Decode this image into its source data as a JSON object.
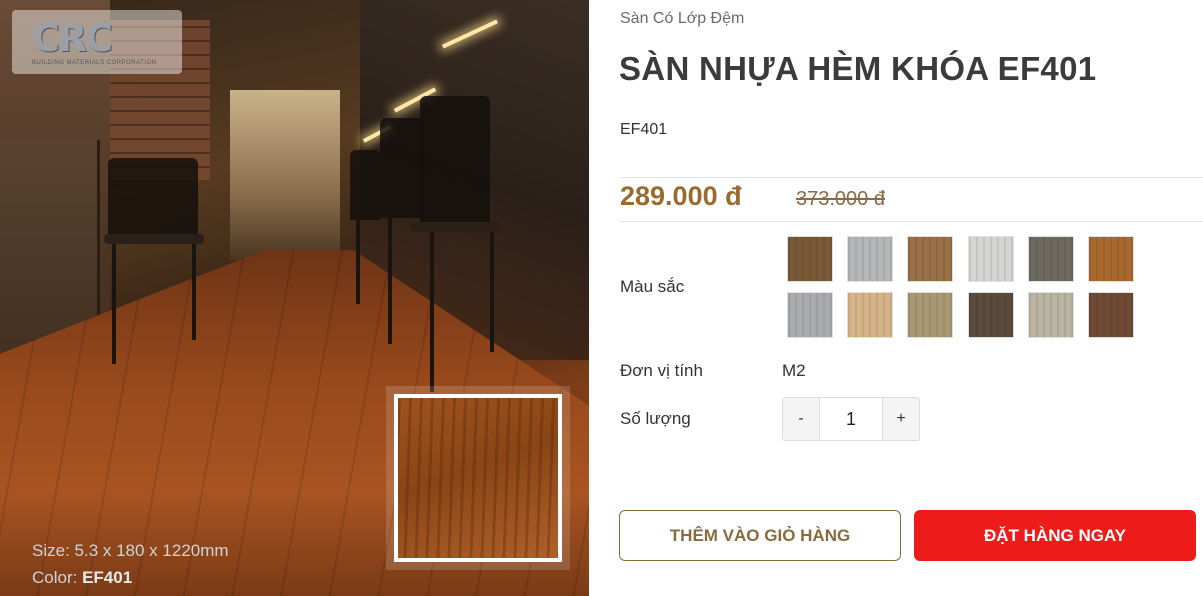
{
  "logo": {
    "mark": "CRC",
    "tagline": "BUILDING MATERIALS CORPORATION"
  },
  "image": {
    "caption_size": "Size: 5.3 x 180 x 1220mm",
    "caption_color_label": "Color: ",
    "caption_color_value": "EF401"
  },
  "breadcrumb": "Sàn Có Lớp Đệm",
  "product": {
    "title": "SÀN NHỰA HÈM KHÓA EF401",
    "sku": "EF401",
    "price_current": "289.000 đ",
    "price_old": "373.000 đ"
  },
  "options": {
    "color_label": "Màu sắc",
    "colors": [
      {
        "name": "walnut-brown",
        "color": "#7a5a36"
      },
      {
        "name": "light-grey",
        "color": "#b4b6b8"
      },
      {
        "name": "striped-oak",
        "color": "#9a7048"
      },
      {
        "name": "white-grey",
        "color": "#d4d4d2"
      },
      {
        "name": "dark-grey-oak",
        "color": "#6e6a60"
      },
      {
        "name": "honey-oak",
        "color": "#a8692e"
      },
      {
        "name": "grey-striped",
        "color": "#a9abae"
      },
      {
        "name": "natural-maple",
        "color": "#d6b487"
      },
      {
        "name": "beige-oak",
        "color": "#a99874"
      },
      {
        "name": "dark-walnut",
        "color": "#5c4a3a"
      },
      {
        "name": "pale-ash",
        "color": "#bab4a0"
      },
      {
        "name": "rustic-brown",
        "color": "#6e4a34"
      }
    ],
    "unit_label": "Đơn vị tính",
    "unit_value": "M2",
    "quantity_label": "Số lượng",
    "quantity_value": "1",
    "minus_label": "-",
    "plus_label": "+"
  },
  "actions": {
    "add_to_cart": "THÊM VÀO GIỎ HÀNG",
    "order_now": "ĐẶT HÀNG NGAY"
  },
  "colors": {
    "price": "#9b6a2f",
    "cart_border": "#8a6a3c",
    "order_bg": "#ee1b1b"
  }
}
